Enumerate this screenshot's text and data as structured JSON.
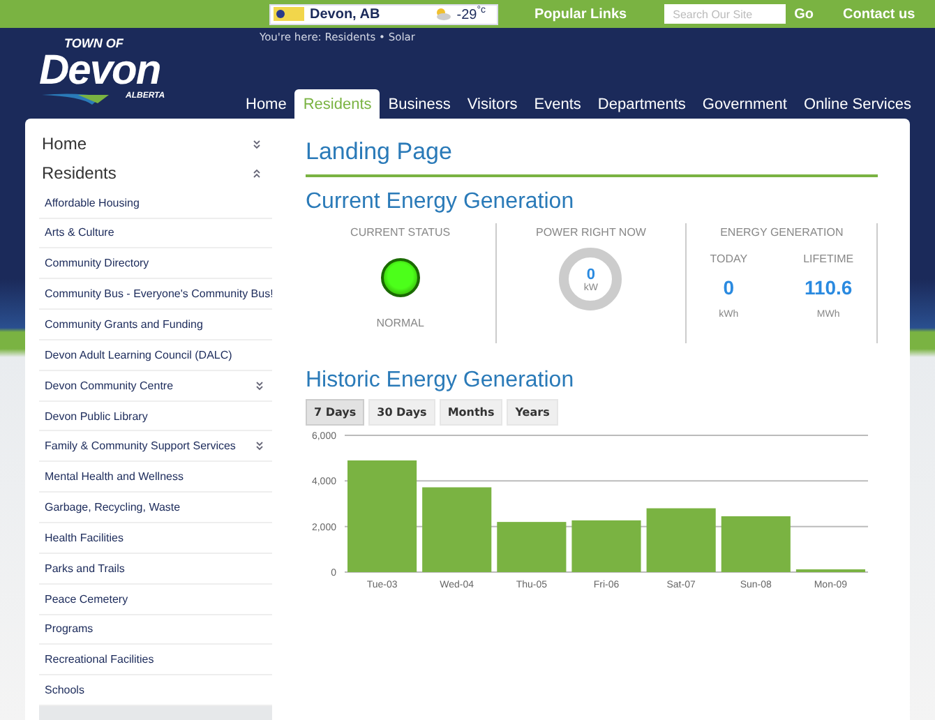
{
  "top_bar": {
    "weather": {
      "city": "Devon, AB",
      "temperature": "-29$^{°c}$"
    },
    "popular_links": "Popular Links",
    "search": {
      "placeholder": "Search Our Site",
      "button": "Go"
    },
    "contact": "Contact us"
  },
  "logo": {
    "prefix": "TOWN OF",
    "name": "Devon",
    "region": "ALBERTA"
  },
  "breadcrumb": "You're here: Residents • Solar",
  "nav": [
    {
      "label": "Home",
      "selected": false
    },
    {
      "label": "Residents",
      "selected": true
    },
    {
      "label": "Business",
      "selected": false
    },
    {
      "label": "Visitors",
      "selected": false
    },
    {
      "label": "Events",
      "selected": false
    },
    {
      "label": "Departments",
      "selected": false
    },
    {
      "label": "Government",
      "selected": false
    },
    {
      "label": "Online Services",
      "selected": false
    }
  ],
  "sidebar": {
    "sections": [
      {
        "label": "Home",
        "expanded": false
      },
      {
        "label": "Residents",
        "expanded": true,
        "children": [
          {
            "label": "Affordable Housing",
            "kind": "page"
          },
          {
            "label": "Arts & Culture",
            "kind": "page"
          },
          {
            "label": "Community Directory",
            "kind": "page"
          },
          {
            "label": "Community Bus - Everyone's Community Bus!",
            "kind": "page"
          },
          {
            "label": "Community Grants and Funding",
            "kind": "page"
          },
          {
            "label": "Devon Adult Learning Council (DALC)",
            "kind": "page"
          },
          {
            "label": "Devon Community Centre",
            "kind": "folder",
            "expanded": false
          },
          {
            "label": "Devon Public Library",
            "kind": "page"
          },
          {
            "label": "Family & Community Support Services",
            "kind": "folder",
            "expanded": false
          },
          {
            "label": "Mental Health and Wellness",
            "kind": "page"
          },
          {
            "label": "Garbage, Recycling, Waste",
            "kind": "page"
          },
          {
            "label": "Health Facilities",
            "kind": "page"
          },
          {
            "label": "Parks and Trails",
            "kind": "page"
          },
          {
            "label": "Peace Cemetery",
            "kind": "page"
          },
          {
            "label": "Programs",
            "kind": "page"
          },
          {
            "label": "Recreational Facilities",
            "kind": "page"
          },
          {
            "label": "Schools",
            "kind": "page"
          }
        ]
      }
    ]
  },
  "content": {
    "title": "Landing Page",
    "current": {
      "title": "Current Energy Generation",
      "status": {
        "label": "CURRENT STATUS",
        "text": "NORMAL"
      },
      "power": {
        "label": "POWER RIGHT NOW",
        "value": "0",
        "unit": "kW"
      },
      "energy": {
        "label": "ENERGY GENERATION",
        "columns": [
          {
            "label": "TODAY",
            "value": "0",
            "unit": "kWh"
          },
          {
            "label": "LIFETIME",
            "value": "110.6",
            "unit": "MWh"
          }
        ]
      }
    },
    "historic": {
      "title": "Historic Energy Generation",
      "ranges": [
        {
          "label": "7 Days",
          "selected": true
        },
        {
          "label": "30 Days",
          "selected": false
        },
        {
          "label": "Months",
          "selected": false
        },
        {
          "label": "Years",
          "selected": false
        }
      ],
      "chart_data": {
        "type": "bar",
        "categories": [
          "Tue-03",
          "Wed-04",
          "Thu-05",
          "Fri-06",
          "Sat-07",
          "Sun-08",
          "Mon-09"
        ],
        "series": [
          {
            "color": "#7ab342",
            "values": [
              4900,
              3720,
              2200,
              2270,
              2800,
              2450,
              120
            ]
          }
        ],
        "ylim": [
          0,
          6000
        ],
        "yticks": [
          {
            "value": 0,
            "label": "0"
          },
          {
            "value": 2000,
            "label": "2,000"
          },
          {
            "value": 4000,
            "label": "4,000"
          },
          {
            "value": 6000,
            "label": "6,000"
          }
        ]
      }
    }
  }
}
